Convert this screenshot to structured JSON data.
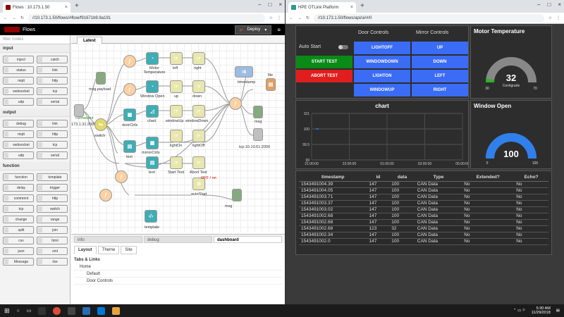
{
  "left_window": {
    "tab_title": "Flows : 10.173.1.50",
    "url": "//10.173.1.50/flows/#flow/f91671b9.9a191",
    "app_name": "Flows",
    "deploy_label": "Deploy",
    "palette": {
      "filter_placeholder": "filter nodes",
      "categories": [
        {
          "name": "input",
          "nodes": [
            "inject",
            "catch",
            "status",
            "link",
            "mqtt",
            "http",
            "websocket",
            "tcp",
            "udp",
            "serial"
          ]
        },
        {
          "name": "output",
          "nodes": [
            "debug",
            "link",
            "mqtt",
            "http",
            "websocket",
            "tcp",
            "udp",
            "serial"
          ]
        },
        {
          "name": "function",
          "nodes": [
            "function",
            "template",
            "delay",
            "trigger",
            "comment",
            "http",
            "tcp",
            "switch",
            "change",
            "range",
            "split",
            "join",
            "csv",
            "html",
            "json",
            "xml",
            "Message",
            "rbe"
          ]
        }
      ]
    },
    "workspace_tab": "Latest",
    "flow_labels": {
      "msg_payload": "msg.payload",
      "connected": "connected",
      "can_in": "173.1.31:2000",
      "switch": "switch",
      "door_ctrls": "doorCtrls",
      "text1": "text",
      "motor_temp": "Motor Temperature",
      "window_open": "Window Open",
      "chart": "chart",
      "mirror_ctrls": "mirrorCtrls",
      "text2": "text",
      "left": "left",
      "right": "right",
      "up": "up",
      "down": "down",
      "window_up": "windowUp",
      "window_down": "windowDown",
      "light_on": "lightOn",
      "light_off": "lightOff",
      "start_test": "Start Test",
      "abort_test": "Abort Test",
      "timestamp": "timestamp",
      "file": "file",
      "msg1": "msg",
      "tcp_out": "tcp:10.10.61:2000",
      "auto_start": "autoStart",
      "auto_off": "OFF / on",
      "msg2": "msg",
      "template": "template"
    },
    "sidebar": {
      "tabs": [
        "info",
        "debug",
        "dashboard"
      ],
      "active_tab": "dashboard",
      "subtabs": [
        "Layout",
        "Theme",
        "Site"
      ],
      "active_subtab": "Layout",
      "section": "Tabs & Links",
      "tree": [
        "Home",
        "Default",
        "Door Controls"
      ]
    }
  },
  "right_window": {
    "tab_title": "HPE OTLink Platform",
    "url": "//10.173.1.50/flows/api/ui/#/0",
    "auto_start_label": "Auto Start",
    "door_header": "Door Controls",
    "mirror_header": "Mirror Controls",
    "start_test": "START TEST",
    "abort_test": "ABORT TEST",
    "door_buttons": [
      "LIGHTOFF",
      "WINDOWDOWN",
      "LIGHTON",
      "WINDOWUP"
    ],
    "mirror_buttons": [
      "UP",
      "DOWN",
      "LEFT",
      "RIGHT"
    ],
    "motor_temp": {
      "title": "Motor Temperature",
      "value": "32",
      "unit": "Centigrade",
      "min": "30",
      "max": "70",
      "fraction": 0.05
    },
    "window_open": {
      "title": "Window Open",
      "value": "100",
      "min": "0",
      "max": "100",
      "fraction": 1.0
    },
    "chart_title": "chart",
    "chart_y_ticks": [
      "101",
      "100",
      "99.5",
      "99"
    ],
    "chart_x_ticks": [
      "21:00:00",
      "23:00:00",
      "01:00:00",
      "03:00:00",
      "05:00:00"
    ],
    "table": {
      "headers": [
        "timestamp",
        "id",
        "data",
        "Type",
        "Extended?",
        "Echo?"
      ],
      "rows": [
        [
          "1543491004.39",
          "147",
          "100",
          "CAN Data",
          "No",
          "No"
        ],
        [
          "1543491004.05",
          "147",
          "100",
          "CAN Data",
          "No",
          "No"
        ],
        [
          "1543491003.71",
          "147",
          "100",
          "CAN Data",
          "No",
          "No"
        ],
        [
          "1543491003.37",
          "147",
          "100",
          "CAN Data",
          "No",
          "No"
        ],
        [
          "1543491003.02",
          "147",
          "100",
          "CAN Data",
          "No",
          "No"
        ],
        [
          "1543491002.68",
          "147",
          "100",
          "CAN Data",
          "No",
          "No"
        ],
        [
          "1543491002.68",
          "147",
          "100",
          "CAN Data",
          "No",
          "No"
        ],
        [
          "1543491002.68",
          "123",
          "32",
          "CAN Data",
          "No",
          "No"
        ],
        [
          "1543491002.34",
          "147",
          "100",
          "CAN Data",
          "No",
          "No"
        ],
        [
          "1543491002.0",
          "147",
          "100",
          "CAN Data",
          "No",
          "No"
        ]
      ]
    }
  },
  "taskbar": {
    "time": "5:30 AM",
    "date": "11/29/2018"
  },
  "colors": {
    "blue_button": "#3b6cf5",
    "green": "#0a8a16",
    "red": "#e01e1e",
    "gauge_blue": "#2f80ed",
    "gauge_gray": "#888888"
  }
}
